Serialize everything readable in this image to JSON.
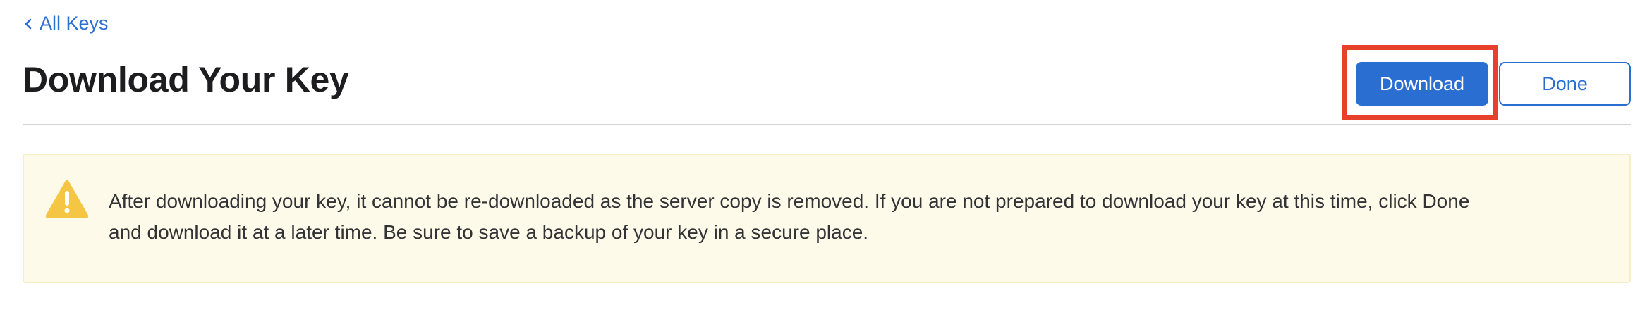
{
  "nav": {
    "back_label": "All Keys"
  },
  "header": {
    "title": "Download Your Key",
    "download_label": "Download",
    "done_label": "Done"
  },
  "notice": {
    "icon": "warning-triangle-icon",
    "message": "After downloading your key, it cannot be re-downloaded as the server copy is removed. If you are not prepared to download your key at this time, click Done and download it at a later time. Be sure to save a backup of your key in a secure place."
  },
  "colors": {
    "accent": "#2a6ed1",
    "highlight": "#e8412b",
    "notice_background": "#fefaea",
    "warning_icon": "#f4c643"
  }
}
